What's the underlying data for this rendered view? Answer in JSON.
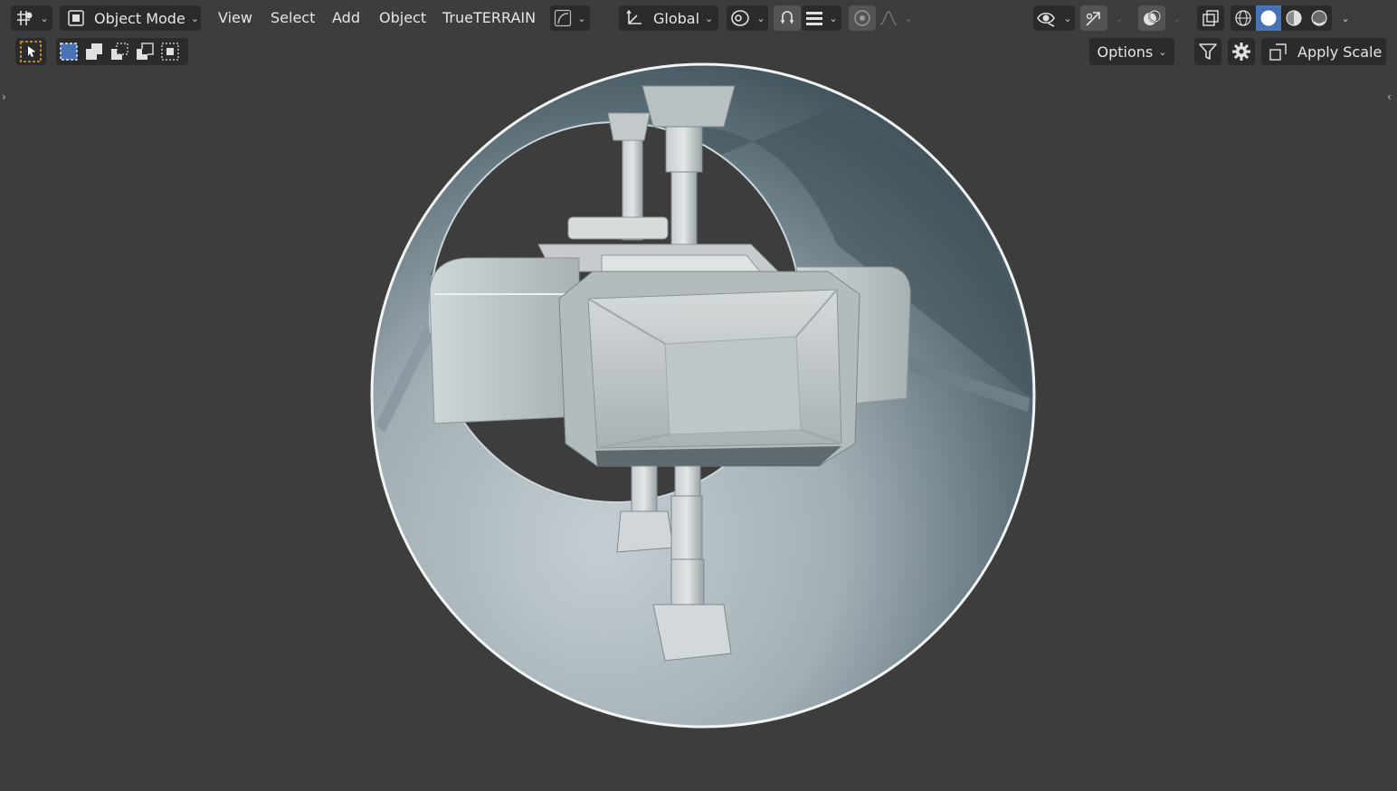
{
  "header": {
    "mode_label": "Object Mode",
    "menus": [
      "View",
      "Select",
      "Add",
      "Object",
      "TrueTERRAIN"
    ],
    "transform_orientation": "Global"
  },
  "tool_settings": {
    "options_label": "Options",
    "apply_scale_label": "Apply Scale"
  },
  "icons": {
    "editor_type": "editor-type-icon",
    "mode": "object-mode-icon",
    "select_tool": "select-cursor-icon",
    "snap": "snap-icon",
    "proportional": "proportional-edit-icon",
    "visibility": "eye-icon",
    "gizmo": "gizmo-icon",
    "overlay": "overlay-icon",
    "xray": "xray-icon",
    "shading_wire": "wireframe-shading-icon",
    "shading_solid": "solid-shading-icon",
    "shading_material": "material-shading-icon",
    "shading_render": "rendered-shading-icon",
    "filter": "filter-icon",
    "settings": "gear-icon"
  },
  "colors": {
    "accent": "#4772b3",
    "background": "#3d3d3d",
    "widget": "#2b2b2b"
  }
}
